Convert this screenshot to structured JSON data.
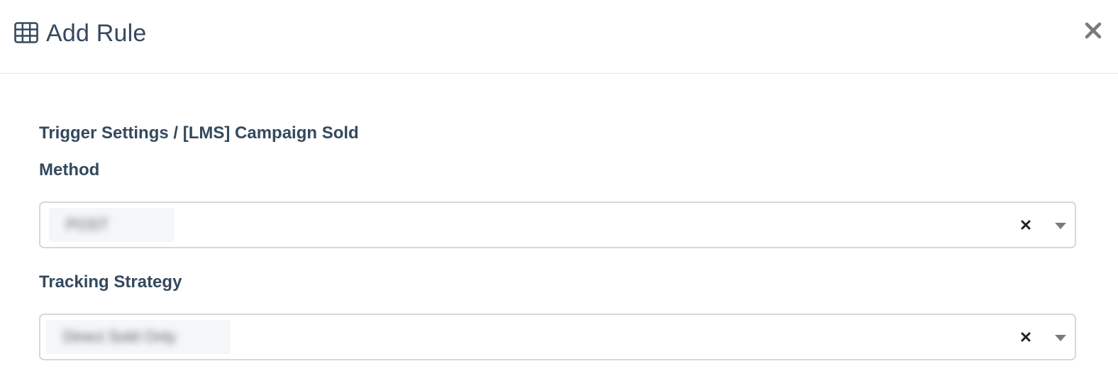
{
  "modal": {
    "title": "Add Rule",
    "icon": "table-icon",
    "close_icon": "close-icon"
  },
  "breadcrumb": "Trigger Settings / [LMS] Campaign Sold",
  "fields": [
    {
      "label": "Method",
      "value": "POST",
      "clear_icon": "clear-icon",
      "dropdown_icon": "chevron-down-icon"
    },
    {
      "label": "Tracking Strategy",
      "value": "Direct Sold Only",
      "clear_icon": "clear-icon",
      "dropdown_icon": "chevron-down-icon"
    }
  ],
  "colors": {
    "text": "#34495e",
    "border": "#d6d8de",
    "divider": "#e3e6ea",
    "icon_gray": "#7a7a7a"
  }
}
